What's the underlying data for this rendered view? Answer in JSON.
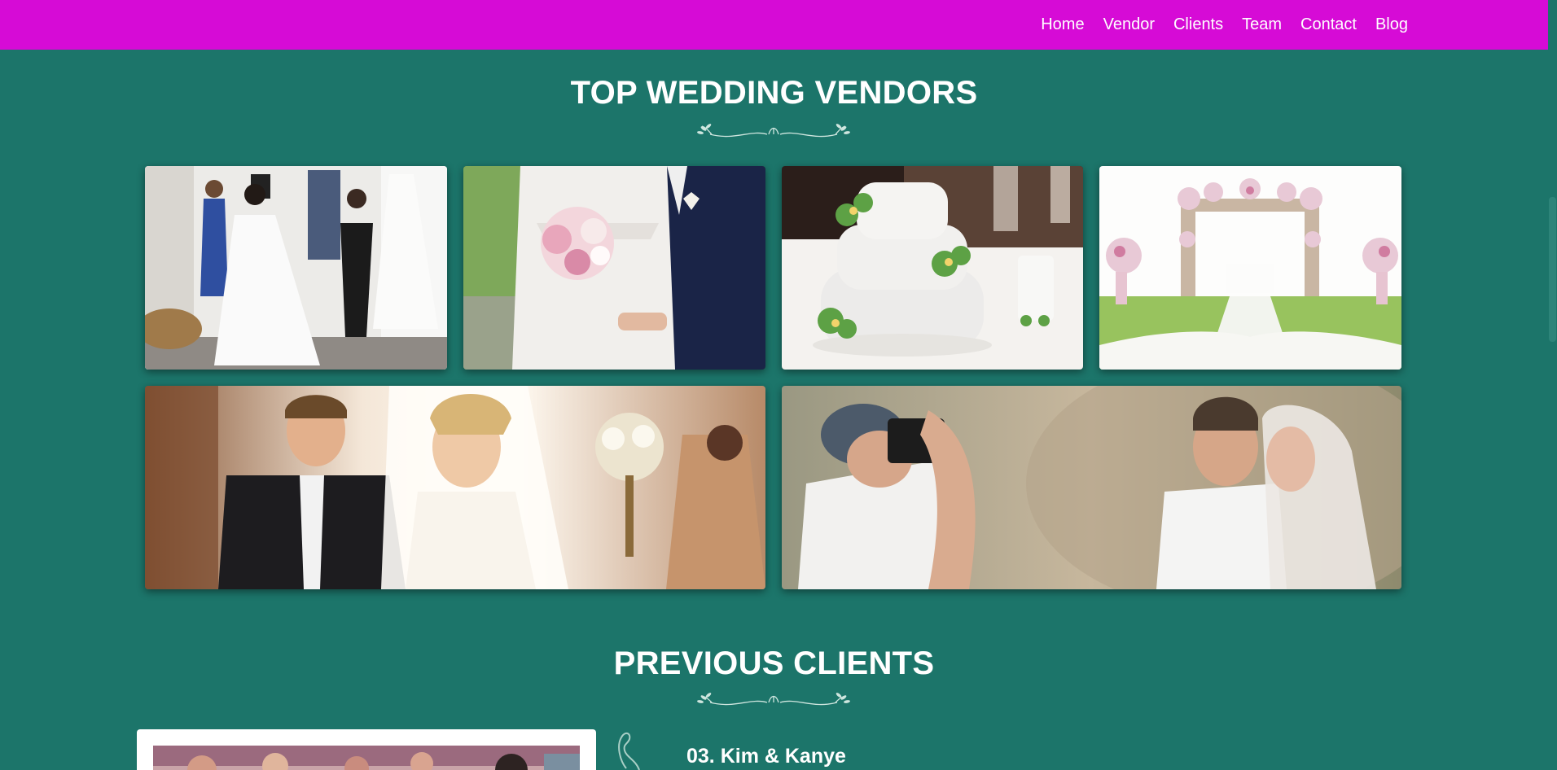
{
  "nav": {
    "items": [
      "Home",
      "Vendor",
      "Clients",
      "Team",
      "Contact",
      "Blog"
    ]
  },
  "sections": {
    "vendors_title": "TOP WEDDING VENDORS",
    "clients_title": "PREVIOUS CLIENTS"
  },
  "gallery": [
    {
      "name": "bridal-dress-fitting-photo",
      "subject": "bride trying on wedding dress with attendants"
    },
    {
      "name": "bride-groom-bouquet-photo",
      "subject": "bride holding bouquet with groom"
    },
    {
      "name": "wedding-cake-photo",
      "subject": "three tier white wedding cake with green flowers"
    },
    {
      "name": "floral-arch-venue-photo",
      "subject": "outdoor ceremony floral arch and aisle"
    },
    {
      "name": "couple-celebration-photo",
      "subject": "bride and groom celebrating outdoors"
    },
    {
      "name": "photographer-couple-photo",
      "subject": "photographer shooting couple"
    }
  ],
  "clients": {
    "current": {
      "title": "03. Kim & Kanye"
    }
  },
  "colors": {
    "navbar": "#d60bd6",
    "page_background": "#1c756a",
    "text": "#ffffff"
  }
}
